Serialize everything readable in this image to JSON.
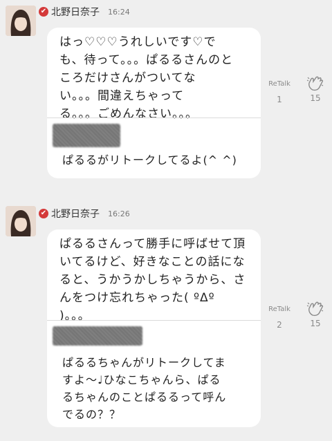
{
  "posts": [
    {
      "author": "北野日奈子",
      "verified_glyph": "✔",
      "time": "16:24",
      "message": "はっ♡♡♡うれしいです♡で\nも、待って。。。ぱるるさんのと\nころだけさんがついてな\nい。。。間違えちゃって\nる。。。ごめんなさい。。。",
      "quoted_text": "ぱるるがリトークしてるよ(^ ^)",
      "retalk_label": "ReTalk",
      "retalk_count": "1",
      "like_count": "15"
    },
    {
      "author": "北野日奈子",
      "verified_glyph": "✔",
      "time": "16:26",
      "message": "ぱるるさんって勝手に呼ばせて頂\nいてるけど、好きなことの話にな\nると、うかうかしちゃうから、さ\nんをつけ忘れちゃった( ºΔº\n)。。。",
      "quoted_text": "ぱるるちゃんがリトークしてま\nすよ～♩ひなこちゃんら、ぱる\nるちゃんのことぱるるって呼ん\nでるの？？",
      "retalk_label": "ReTalk",
      "retalk_count": "2",
      "like_count": "15"
    }
  ],
  "colors": {
    "background": "#efefef",
    "bubble": "#ffffff",
    "verified": "#d43a3a"
  }
}
